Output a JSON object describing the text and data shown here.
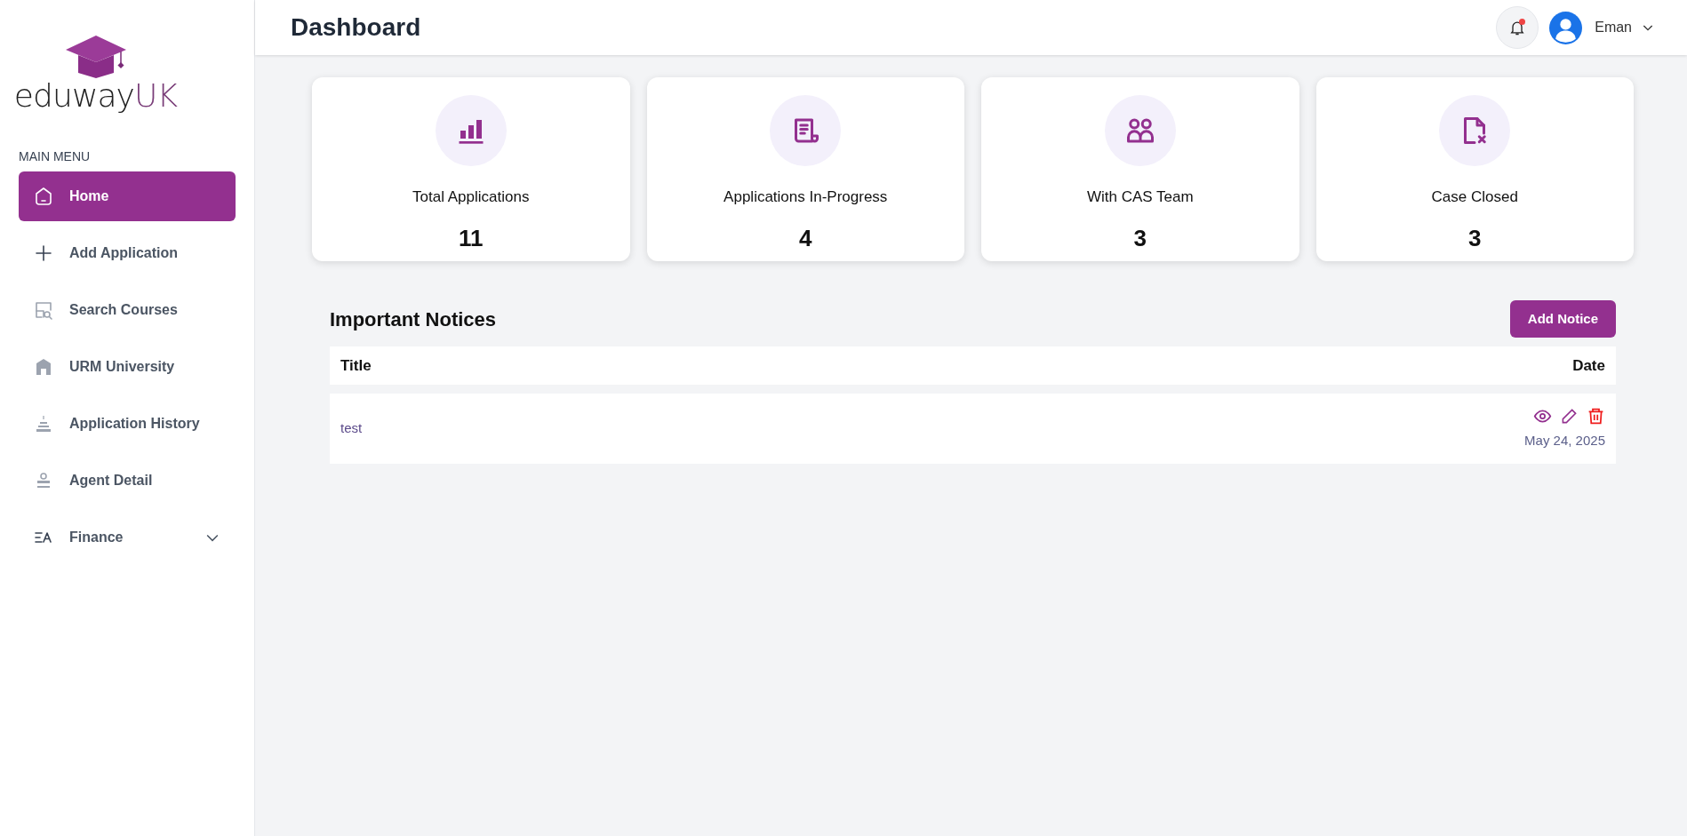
{
  "logo": {
    "text": "eduway",
    "accent": "UK"
  },
  "sidebar": {
    "heading": "MAIN MENU",
    "items": [
      {
        "label": "Home",
        "selected": true
      },
      {
        "label": "Add Application",
        "selected": false
      },
      {
        "label": "Search Courses",
        "selected": false
      },
      {
        "label": "URM University",
        "selected": false
      },
      {
        "label": "Application History",
        "selected": false
      },
      {
        "label": "Agent Detail",
        "selected": false
      },
      {
        "label": "Finance",
        "selected": false,
        "expanded": false
      }
    ]
  },
  "header": {
    "title": "Dashboard",
    "notification_unread": true,
    "user": "Eman"
  },
  "stats": [
    {
      "label": "Total Applications",
      "value": "11"
    },
    {
      "label": "Applications In-Progress",
      "value": "4"
    },
    {
      "label": "With CAS Team",
      "value": "3"
    },
    {
      "label": "Case Closed",
      "value": "3"
    }
  ],
  "notices": {
    "title": "Important Notices",
    "add_button": "Add Notice",
    "columns": [
      "Title",
      "Date"
    ],
    "rows": [
      {
        "title": "test",
        "date": "May 24, 2025"
      }
    ]
  }
}
